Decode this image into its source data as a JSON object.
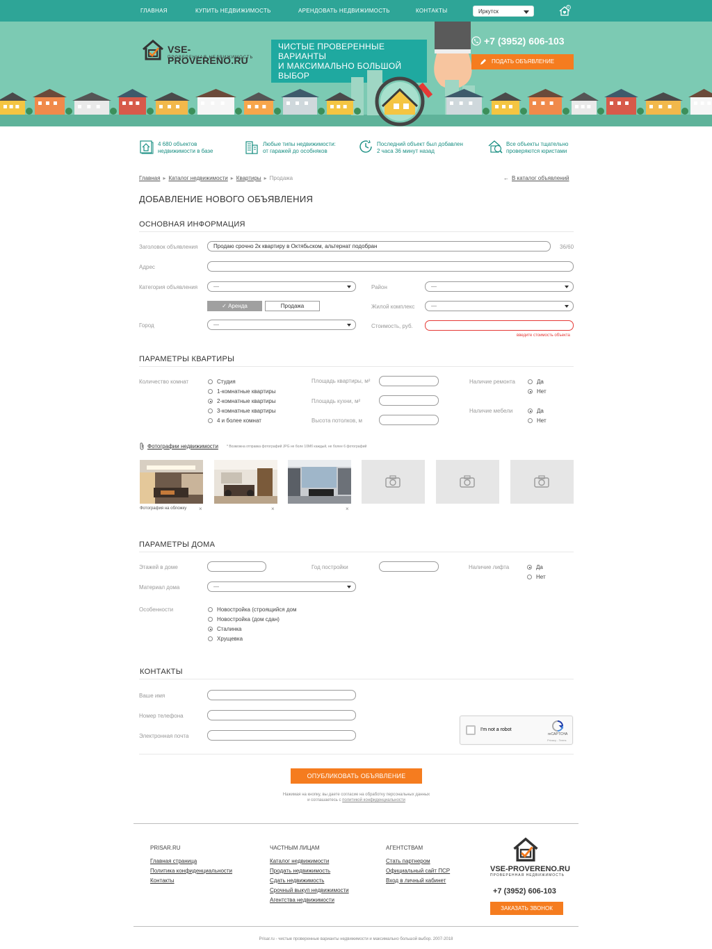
{
  "nav": {
    "items": [
      "ГЛАВНАЯ",
      "КУПИТЬ НЕДВИЖИМОСТЬ",
      "АРЕНДОВАТЬ НЕДВИЖИМОСТЬ",
      "КОНТАКТЫ"
    ],
    "city": "Иркутск",
    "fav_count": "0"
  },
  "header": {
    "logo_text": "VSE-PROVERENO.RU",
    "logo_sub": "ПРОВЕРЕННАЯ НЕДВИЖИМОСТЬ",
    "slogan": [
      "ЧИСТЫЕ ПРОВЕРЕННЫЕ ВАРИАНТЫ",
      "И МАКСИМАЛЬНО БОЛЬШОЙ ВЫБОР"
    ],
    "phone": "+7 (3952) 606-103",
    "post_ad": "ПОДАТЬ ОБЪЯВЛЕНИЕ"
  },
  "features": [
    {
      "icon": "database-icon",
      "lines": [
        "4 680 объектов",
        "недвижимости в базе"
      ]
    },
    {
      "icon": "building-icon",
      "lines": [
        "Любые типы недвижимости:",
        "от гаражей до особняков"
      ]
    },
    {
      "icon": "clock-icon",
      "lines": [
        "Последний объект был добавлен",
        "2 часа 36 минут назад"
      ]
    },
    {
      "icon": "lawyer-icon",
      "lines": [
        "Все объекты тщательно",
        "проверяются юристами"
      ]
    }
  ],
  "breadcrumb": [
    "Главная",
    "Каталог недвижимости",
    "Квартиры",
    "Продажа"
  ],
  "back_link": "В каталог объявлений",
  "page_title": "ДОБАВЛЕНИЕ НОВОГО ОБЪЯВЛЕНИЯ",
  "basic": {
    "title": "ОСНОВНАЯ ИНФОРМАЦИЯ",
    "ad_title_label": "Заголовок объявления",
    "ad_title_value": "Продаю срочно 2к квартиру в Октябьском, альтернат подобран",
    "ad_title_counter": "36/60",
    "address_label": "Адрес",
    "address_value": "",
    "category_label": "Категория объявления",
    "category_value": "—",
    "rent_label": "Аренда",
    "sale_label": "Продажа",
    "city_label": "Город",
    "city_value": "—",
    "district_label": "Район",
    "district_value": "—",
    "complex_label": "Жилой комплекс",
    "complex_value": "—",
    "price_label": "Стоимость, руб.",
    "price_value": "",
    "price_error": "введите стоимость объекта"
  },
  "flat": {
    "title": "ПАРАМЕТРЫ КВАРТИРЫ",
    "rooms_label": "Количество комнат",
    "rooms": [
      {
        "label": "Студия",
        "checked": false
      },
      {
        "label": "1-комнатные квартиры",
        "checked": false
      },
      {
        "label": "2-комнатные квартиры",
        "checked": true
      },
      {
        "label": "3-комнатные квартиры",
        "checked": false
      },
      {
        "label": "4 и более комнат",
        "checked": false
      }
    ],
    "area_label": "Площадь квартиры, м²",
    "kitchen_label": "Площадь кухни, м²",
    "ceiling_label": "Высота потолков, м",
    "repair_label": "Наличие ремонта",
    "repair": [
      {
        "label": "Да",
        "checked": false
      },
      {
        "label": "Нет",
        "checked": true
      }
    ],
    "furniture_label": "Наличие мебели",
    "furniture": [
      {
        "label": "Да",
        "checked": true
      },
      {
        "label": "Нет",
        "checked": false
      }
    ]
  },
  "photos": {
    "link": "Фотографии недвижимости",
    "note": "* Возможна отправка фотографий JPG не боле 10Мб каждый, не более 6 фотографий",
    "cover_label": "Фотография на обложку",
    "remove": "×"
  },
  "house": {
    "title": "ПАРАМЕТРЫ ДОМА",
    "floors_label": "Этажей в доме",
    "year_label": "Год постройки",
    "lift_label": "Наличие лифта",
    "lift": [
      {
        "label": "Да",
        "checked": true
      },
      {
        "label": "Нет",
        "checked": false
      }
    ],
    "material_label": "Материал дома",
    "material_value": "—",
    "features_label": "Особенности",
    "features": [
      {
        "label": "Новостройка (строящийся дом",
        "checked": false
      },
      {
        "label": "Новостройка (дом сдан)",
        "checked": false
      },
      {
        "label": "Сталинка",
        "checked": true
      },
      {
        "label": "Хрущевка",
        "checked": false
      }
    ]
  },
  "contacts": {
    "title": "КОНТАКТЫ",
    "name_label": "Ваше имя",
    "phone_label": "Номер телефона",
    "email_label": "Электронная почта"
  },
  "captcha": {
    "text": "I'm not a robot",
    "brand": "reCAPTCHA",
    "links": "Privacy - Terms"
  },
  "publish": "ОПУБЛИКОВАТЬ ОБЪЯВЛЕНИЕ",
  "consent": {
    "line1": "Нажимая на кнопку, вы даете согласие на обработку персональных данных",
    "line2_pre": "и соглашаетесь с ",
    "line2_link": "политикой конфиденциальности"
  },
  "footer": {
    "col1": {
      "title": "PRISAR.RU",
      "links": [
        "Главная страница",
        "Политика конфиденциальности",
        "Контакты"
      ]
    },
    "col2": {
      "title": "ЧАСТНЫМ ЛИЦАМ",
      "links": [
        "Каталог недвижимости",
        "Продать недвижимость",
        "Сдать недвижимость",
        "Срочный выкуп недвижимости",
        "Агентства недвижимости"
      ]
    },
    "col3": {
      "title": "АГЕНТСТВАМ",
      "links": [
        "Стать партнером",
        "Официальный сайт ПСР",
        "Вход в личный кабинет"
      ]
    },
    "logo_text": "VSE-PROVERENO.RU",
    "logo_sub": "ПРОВЕРЕННАЯ НЕДВИЖИМОСТЬ",
    "phone": "+7 (3952) 606-103",
    "callback": "ЗАКАЗАТЬ ЗВОНОК",
    "copyright": "Prisar.ru - чистые проверенные варианты недвижимости и максимально большой выбор. 2007-2018"
  },
  "colors": {
    "teal": "#2ea597",
    "mint": "#7ccab3",
    "orange": "#f57c1f",
    "error": "#e53935"
  }
}
